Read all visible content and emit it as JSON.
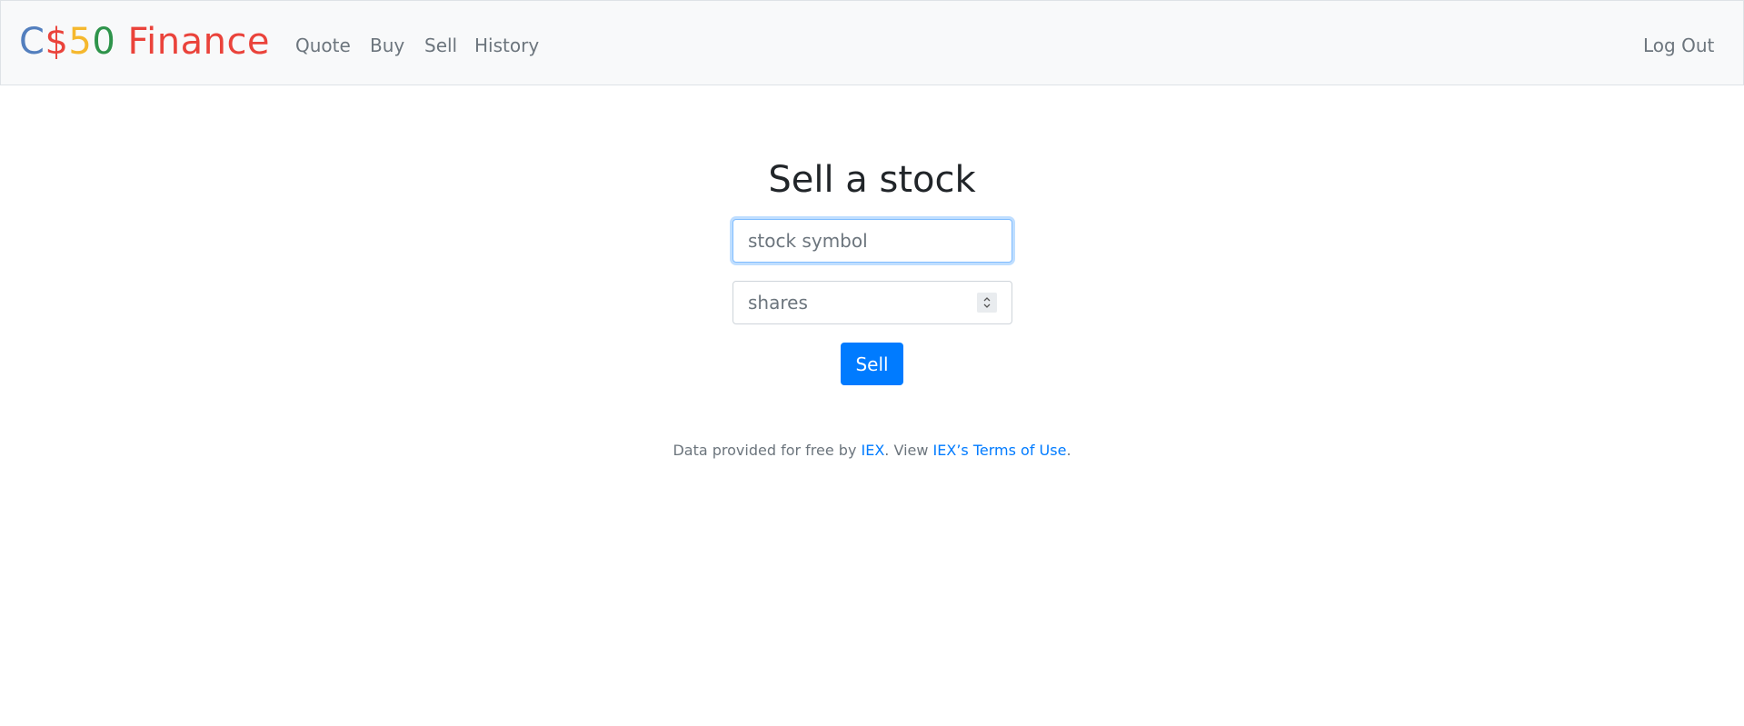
{
  "brand": {
    "c": "C",
    "dollar": "$",
    "five": "5",
    "zero": "0",
    "finance": "Finance",
    "colors": {
      "c": "#537fbe",
      "dollar": "#ea433b",
      "five": "#f5b82e",
      "zero": "#2e944b",
      "finance": "#ea433b"
    }
  },
  "nav": {
    "quote": "Quote",
    "buy": "Buy",
    "sell": "Sell",
    "history": "History",
    "logout": "Log Out"
  },
  "main": {
    "title": "Sell a stock",
    "symbol_placeholder": "stock symbol",
    "symbol_value": "",
    "shares_placeholder": "shares",
    "shares_value": "",
    "sell_button": "Sell"
  },
  "footer": {
    "prefix": "Data provided for free by ",
    "iex_link": "IEX",
    "middle": ". View ",
    "terms_link": "IEX’s Terms of Use",
    "suffix": "."
  },
  "colors": {
    "primary": "#007bff",
    "navbar_bg": "#f8f9fa",
    "muted_text": "#6c757d",
    "heading_text": "#212529"
  },
  "icons": {
    "spinner": "number-stepper-icon"
  }
}
